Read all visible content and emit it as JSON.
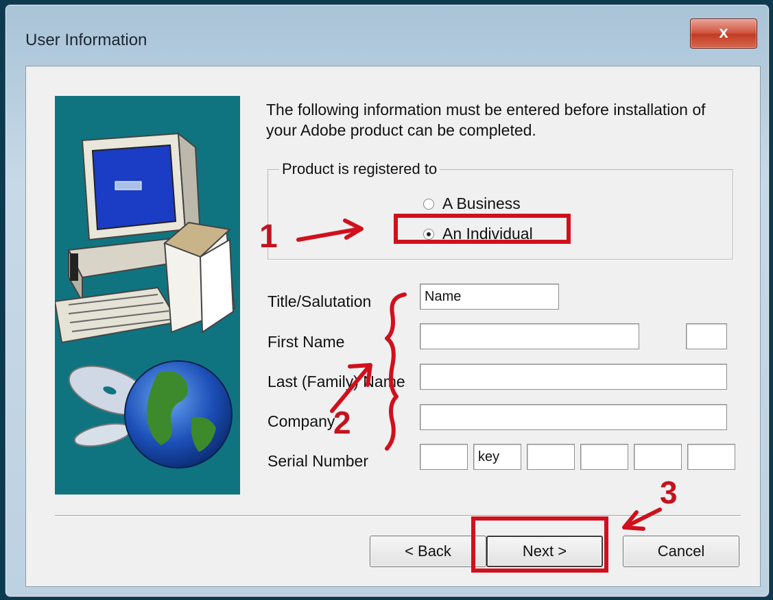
{
  "window": {
    "title": "User Information",
    "close_glyph": "x"
  },
  "intro_text": "The following information must be entered before installation of your Adobe product can be completed.",
  "registration": {
    "group_label": "Product is registered to",
    "options": [
      {
        "label": "A Business",
        "selected": false
      },
      {
        "label": "An Individual",
        "selected": true
      }
    ]
  },
  "form": {
    "title_label": "Title/Salutation",
    "first_name_label": "First Name",
    "last_name_label": "Last (Family) Name",
    "company_label": "Company",
    "serial_label": "Serial Number",
    "title_value": "Name",
    "serial_values": [
      "",
      "key",
      "",
      "",
      "",
      ""
    ]
  },
  "buttons": {
    "back": "< Back",
    "next": "Next >",
    "cancel": "Cancel"
  },
  "annotations": {
    "step1": "1",
    "step2": "2",
    "step3": "3",
    "color": "#d0101d"
  },
  "icons": [
    "computer-icon",
    "cd-icon",
    "globe-icon",
    "close-icon"
  ]
}
